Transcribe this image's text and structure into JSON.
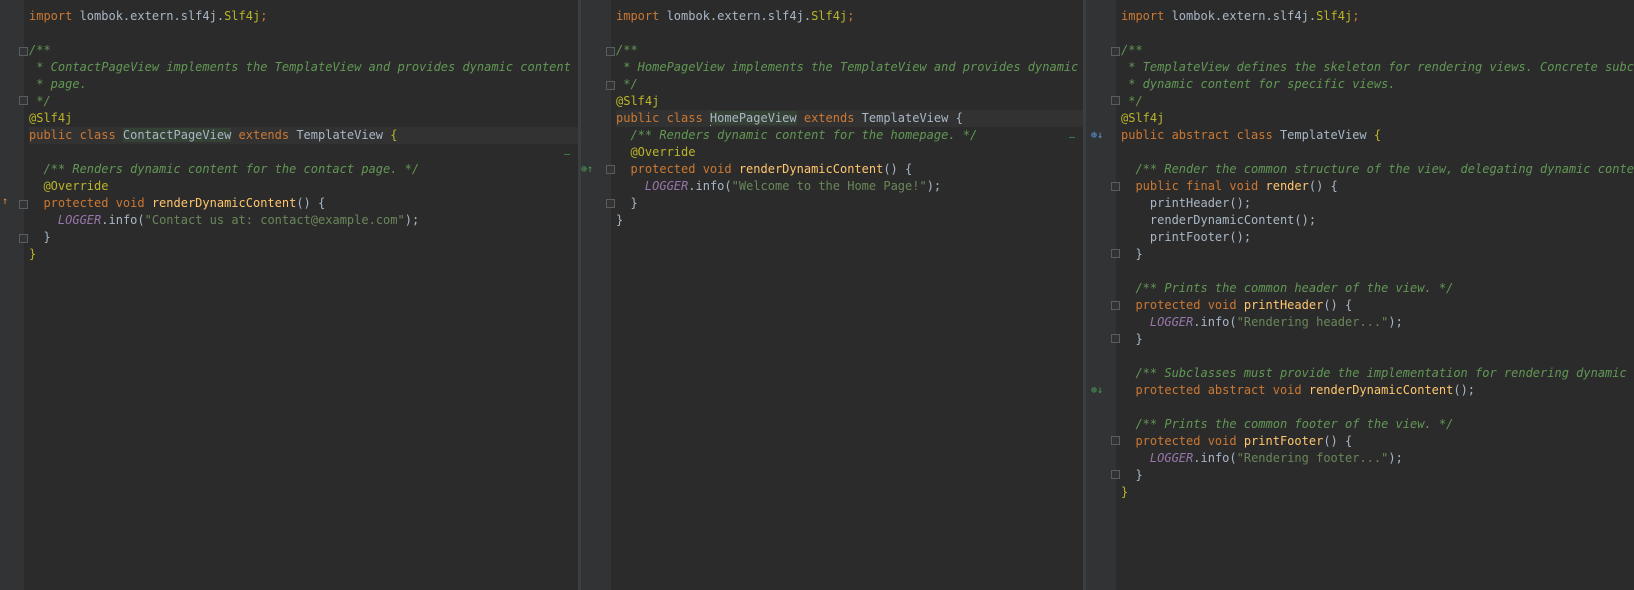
{
  "left": {
    "lines": [
      [
        {
          "t": "import ",
          "c": "kw"
        },
        {
          "t": "lombok.extern.slf4j.",
          "c": ""
        },
        {
          "t": "Slf4j",
          "c": "ann"
        },
        {
          "t": ";",
          "c": "kw"
        }
      ],
      [],
      [
        {
          "t": "/**",
          "c": "cm"
        }
      ],
      [
        {
          "t": " * ContactPageView implements the TemplateView and provides dynamic content spe",
          "c": "cm"
        }
      ],
      [
        {
          "t": " * page.",
          "c": "cm"
        }
      ],
      [
        {
          "t": " */",
          "c": "cm"
        }
      ],
      [
        {
          "t": "@Slf4j",
          "c": "ann"
        }
      ],
      [
        {
          "t": "public class ",
          "c": "kw"
        },
        {
          "t": "ContactPageView",
          "c": "hl"
        },
        {
          "t": " extends ",
          "c": "kw"
        },
        {
          "t": "TemplateView ",
          "c": ""
        },
        {
          "t": "{",
          "c": "ann"
        }
      ],
      [],
      [
        {
          "t": "  /** Renders dynamic content for the contact page. */",
          "c": "cm"
        }
      ],
      [
        {
          "t": "  @Override",
          "c": "ann"
        }
      ],
      [
        {
          "t": "  protected void ",
          "c": "kw"
        },
        {
          "t": "renderDynamicContent",
          "c": "fn"
        },
        {
          "t": "() {",
          "c": ""
        }
      ],
      [
        {
          "t": "    ",
          "c": ""
        },
        {
          "t": "LOGGER",
          "c": "fld"
        },
        {
          "t": ".info(",
          "c": ""
        },
        {
          "t": "\"Contact us at: contact@example.com\"",
          "c": "str"
        },
        {
          "t": ");",
          "c": ""
        }
      ],
      [
        {
          "t": "  }",
          "c": ""
        }
      ],
      [
        {
          "t": "}",
          "c": "ann"
        }
      ]
    ]
  },
  "middle": {
    "lines": [
      [
        {
          "t": "import ",
          "c": "kw"
        },
        {
          "t": "lombok.extern.slf4j.",
          "c": ""
        },
        {
          "t": "Slf4j",
          "c": "ann"
        },
        {
          "t": ";",
          "c": "kw"
        }
      ],
      [],
      [
        {
          "t": "/**",
          "c": "cm"
        }
      ],
      [
        {
          "t": " * HomePageView implements the TemplateView and provides dynamic co",
          "c": "cm"
        }
      ],
      [
        {
          "t": " */",
          "c": "cm"
        }
      ],
      [
        {
          "t": "@Slf4j",
          "c": "ann"
        }
      ],
      [
        {
          "t": "public class ",
          "c": "kw"
        },
        {
          "t": "HomePageView",
          "c": "hl"
        },
        {
          "t": " extends ",
          "c": "kw"
        },
        {
          "t": "TemplateView ",
          "c": ""
        },
        {
          "t": "{",
          "c": ""
        }
      ],
      [
        {
          "t": "  /** Renders dynamic content for the homepage. */",
          "c": "cm"
        }
      ],
      [
        {
          "t": "  @Override",
          "c": "ann"
        }
      ],
      [
        {
          "t": "  protected void ",
          "c": "kw"
        },
        {
          "t": "renderDynamicContent",
          "c": "fn"
        },
        {
          "t": "() {",
          "c": ""
        }
      ],
      [
        {
          "t": "    ",
          "c": ""
        },
        {
          "t": "LOGGER",
          "c": "fld"
        },
        {
          "t": ".info(",
          "c": ""
        },
        {
          "t": "\"Welcome to the Home Page!\"",
          "c": "str"
        },
        {
          "t": ");",
          "c": ""
        }
      ],
      [
        {
          "t": "  }",
          "c": ""
        }
      ],
      [
        {
          "t": "}",
          "c": ""
        }
      ]
    ]
  },
  "right": {
    "lines": [
      [
        {
          "t": "import ",
          "c": "kw"
        },
        {
          "t": "lombok.extern.slf4j.",
          "c": ""
        },
        {
          "t": "Slf4j",
          "c": "ann"
        },
        {
          "t": ";",
          "c": "kw"
        }
      ],
      [],
      [
        {
          "t": "/**",
          "c": "cm"
        }
      ],
      [
        {
          "t": " * TemplateView defines the skeleton for rendering views. Concrete subcla",
          "c": "cm"
        }
      ],
      [
        {
          "t": " * dynamic content for specific views.",
          "c": "cm"
        }
      ],
      [
        {
          "t": " */",
          "c": "cm"
        }
      ],
      [
        {
          "t": "@Slf4j",
          "c": "ann"
        }
      ],
      [
        {
          "t": "public abstract class ",
          "c": "kw"
        },
        {
          "t": "TemplateView ",
          "c": ""
        },
        {
          "t": "{",
          "c": "ann"
        }
      ],
      [],
      [
        {
          "t": "  /** Render the common structure of the view, delegating dynamic content",
          "c": "cm"
        }
      ],
      [
        {
          "t": "  public final void ",
          "c": "kw"
        },
        {
          "t": "render",
          "c": "fn"
        },
        {
          "t": "() {",
          "c": ""
        }
      ],
      [
        {
          "t": "    printHeader();",
          "c": ""
        }
      ],
      [
        {
          "t": "    renderDynamicContent();",
          "c": ""
        }
      ],
      [
        {
          "t": "    printFooter();",
          "c": ""
        }
      ],
      [
        {
          "t": "  }",
          "c": ""
        }
      ],
      [],
      [
        {
          "t": "  /** Prints the common header of the view. */",
          "c": "cm"
        }
      ],
      [
        {
          "t": "  protected void ",
          "c": "kw"
        },
        {
          "t": "printHeader",
          "c": "fn"
        },
        {
          "t": "() {",
          "c": ""
        }
      ],
      [
        {
          "t": "    ",
          "c": ""
        },
        {
          "t": "LOGGER",
          "c": "fld"
        },
        {
          "t": ".info(",
          "c": ""
        },
        {
          "t": "\"Rendering header...\"",
          "c": "str"
        },
        {
          "t": ");",
          "c": ""
        }
      ],
      [
        {
          "t": "  }",
          "c": ""
        }
      ],
      [],
      [
        {
          "t": "  /** Subclasses must provide the implementation for rendering dynamic co",
          "c": "cm"
        }
      ],
      [
        {
          "t": "  protected abstract void ",
          "c": "kw"
        },
        {
          "t": "renderDynamicContent",
          "c": "fn"
        },
        {
          "t": "();",
          "c": ""
        }
      ],
      [],
      [
        {
          "t": "  /** Prints the common footer of the view. */",
          "c": "cm"
        }
      ],
      [
        {
          "t": "  protected void ",
          "c": "kw"
        },
        {
          "t": "printFooter",
          "c": "fn"
        },
        {
          "t": "() {",
          "c": ""
        }
      ],
      [
        {
          "t": "    ",
          "c": ""
        },
        {
          "t": "LOGGER",
          "c": "fld"
        },
        {
          "t": ".info(",
          "c": ""
        },
        {
          "t": "\"Rendering footer...\"",
          "c": "str"
        },
        {
          "t": ");",
          "c": ""
        }
      ],
      [
        {
          "t": "  }",
          "c": ""
        }
      ],
      [
        {
          "t": "}",
          "c": "ann"
        }
      ]
    ]
  },
  "colors": {
    "background": "#2b2b2b",
    "gutter": "#313335",
    "keyword": "#cc7832",
    "annotation": "#bbb529",
    "comment": "#629755",
    "string": "#6a8759",
    "field": "#9876aa",
    "method": "#ffc66d",
    "text": "#a9b7c6"
  },
  "icons": [
    "fold-icon",
    "implemented-method-icon",
    "overridden-method-icon",
    "implementing-method-icon"
  ]
}
